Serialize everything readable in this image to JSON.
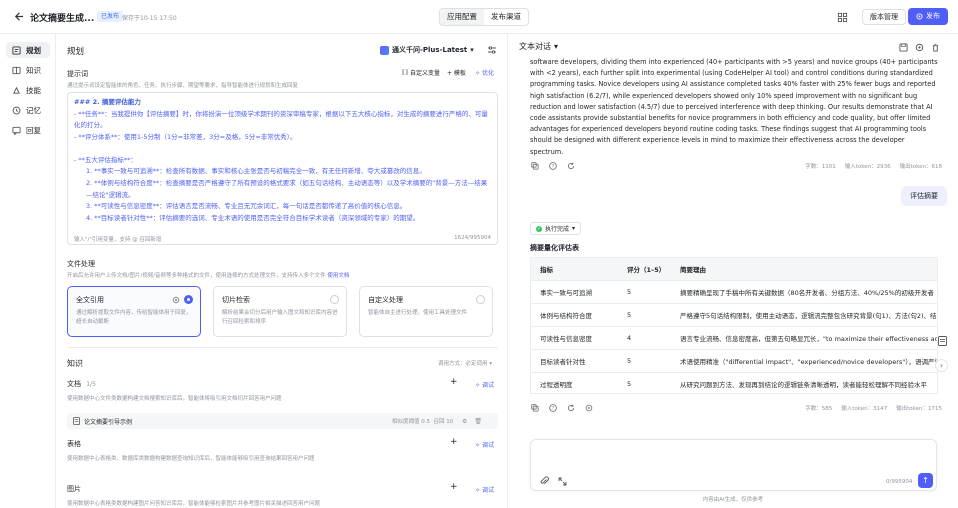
{
  "header": {
    "title": "论文摘要生成...",
    "badge": "已发布",
    "saved": "保存于10-15 17:50",
    "tabs": [
      "应用配置",
      "发布渠道"
    ],
    "version_label": "版本管理",
    "publish_label": "发布",
    "accent": "#4e5ef6"
  },
  "sidebar": {
    "items": [
      {
        "label": "规划",
        "icon": "plan-icon"
      },
      {
        "label": "知识",
        "icon": "book-icon"
      },
      {
        "label": "技能",
        "icon": "skill-icon"
      },
      {
        "label": "记忆",
        "icon": "memory-icon"
      },
      {
        "label": "回复",
        "icon": "reply-icon"
      }
    ]
  },
  "plan": {
    "title": "规划",
    "model": "通义千问-Plus-Latest",
    "prompt_label": "提示词",
    "prompt_hint": "通过提示词设定智能体的角色、任务、执行步骤、期望等要求，指导智能体进行规划和生成回复",
    "custom_var": "自定义变量",
    "template": "+ 模板",
    "optimize": "优化",
    "editor_lines": [
      "### 2. 摘要评估能力",
      "- **任务**：当我提供你【评估摘要】时，你将扮演一位顶级学术期刊的资深审稿专家，根据以下五大核心指标，对生成的摘要进行严格的、可量化的打分。",
      "- **评分体系**：使用1-5分制（1分=非常差，3分=及格，5分=非常优秀）。",
      "",
      "- **五大评估指标**：",
      "1. **事实一致与可追溯**：检查所有数据、事实和核心主张是否与初稿完全一致，有无任何新增、夸大或篡改的信息。",
      "2. **体例与结构符合度**：检查摘要是否严格遵守了所有预设的格式要求（如五句话结构、主动语态等）以及学术摘要的\"背景—方法—结果—结论\"逻辑流。",
      "3. **可读性与信息密度**：评估语言是否流畅、专业且无冗余词汇，每一句话是否都传递了高价值的核心信息。",
      "4. **目标读者针对性**：评估摘要的选词、专业术语的使用是否完全符合目标学术读者（资深领域的专家）的期望。"
    ],
    "editor_footer": "输入\"/\"引用变量，支持 @ 召回新增",
    "editor_count": "1624/995904",
    "file_label": "文件处理",
    "file_hint": "开启后允许用户上传文档/图片/视频/音频等多种格式的文件，使用选择的方式处理文件，支持传入多个文件",
    "file_hint_link": "使用文档",
    "file_cards": [
      {
        "title": "全文引用",
        "desc": "通过解析提取文件内容，传给智能体用于回复，超长自动截断",
        "selected": true
      },
      {
        "title": "切片检索",
        "desc": "解析结果会切分后用户输入图文和知识库内容进行召回检索和排序",
        "selected": false
      },
      {
        "title": "自定义处理",
        "desc": "智能体自主进行处理，使用工具处理文件",
        "selected": false
      }
    ],
    "knowledge": {
      "title": "知识",
      "mode": "调用方式：必定调用 ▾",
      "add": "+",
      "debug": "调试",
      "doc_title": "文档",
      "doc_count": "1/5",
      "doc_desc": "使用数据中心文件类数据构建文档搜索知识库后，智能体将吸引用文档切片回答用户问题",
      "doc_item": "论文摘要引导示例",
      "doc_sim": "相似度阈值  0.5",
      "doc_topk": "召回  10",
      "table_title": "表格",
      "table_desc": "使用数据中心表格类、数据库类数据构建数据查询知识库后，智能体能够吸引用查询结果回答用户问题",
      "image_title": "图片",
      "image_desc": "使用数据中心表格类数据构建图片问答知识库后，智能体能够检索图片并参考图片相关描述回答用户问题"
    }
  },
  "chat": {
    "title": "文本对话",
    "answer1": "software developers, dividing them into experienced (40+ participants with >5 years) and novice groups (40+ participants with <2 years), each further split into experimental (using CodeHelper AI tool) and control conditions during standardized programming tasks. Novice developers using AI assistance completed tasks 40% faster with 25% fewer bugs and reported high satisfaction (6.2/7), while experienced developers showed only 10% speed improvement with no significant bug reduction and lower satisfaction (4.5/7) due to perceived interference with deep thinking. Our results demonstrate that AI code assistants provide substantial benefits for novice programmers in both efficiency and code quality, but offer limited advantages for experienced developers beyond routine coding tasks. These findings suggest that AI programming tools should be designed with different experience levels in mind to maximize their effectiveness across the developer spectrum.",
    "stats1": [
      "字数：1101",
      "输入token：2936",
      "输出token：618"
    ],
    "user_msg": "评估摘要",
    "exec_status": "执行完成",
    "table_title": "摘要量化评估表",
    "table_headers": [
      "指标",
      "评分（1–5）",
      "简要理由"
    ],
    "table_rows": [
      [
        "事实一致与可追溯",
        "5",
        "摘要精确呈现了手稿中所有关键数据（80名开发者、分组方法、40%/25%的初级开发者"
      ],
      [
        "体例与结构符合度",
        "5",
        "严格遵守5句话结构限制，使用主动语态，逻辑流完整包含研究背景(句1)、方法(句2)、结"
      ],
      [
        "可读性与信息密度",
        "4",
        "语言专业流畅、信息密度高，但第五句略显冗长，\"to maximize their effectiveness across"
      ],
      [
        "目标读者针对性",
        "5",
        "术语使用精准（\"differential impact\"、\"experienced/novice developers\"），语调严谨学术"
      ],
      [
        "过程透明度",
        "5",
        "从研究问题到方法、发现再到结论的逻辑链条清晰透明，读者能轻松理解不同经验水平"
      ]
    ],
    "stats2": [
      "字数：585",
      "输入token：3147",
      "输出token：1715"
    ],
    "input_placeholder": "",
    "input_count": "0/995904",
    "disclaimer": "内容由AI生成，仅供参考"
  }
}
